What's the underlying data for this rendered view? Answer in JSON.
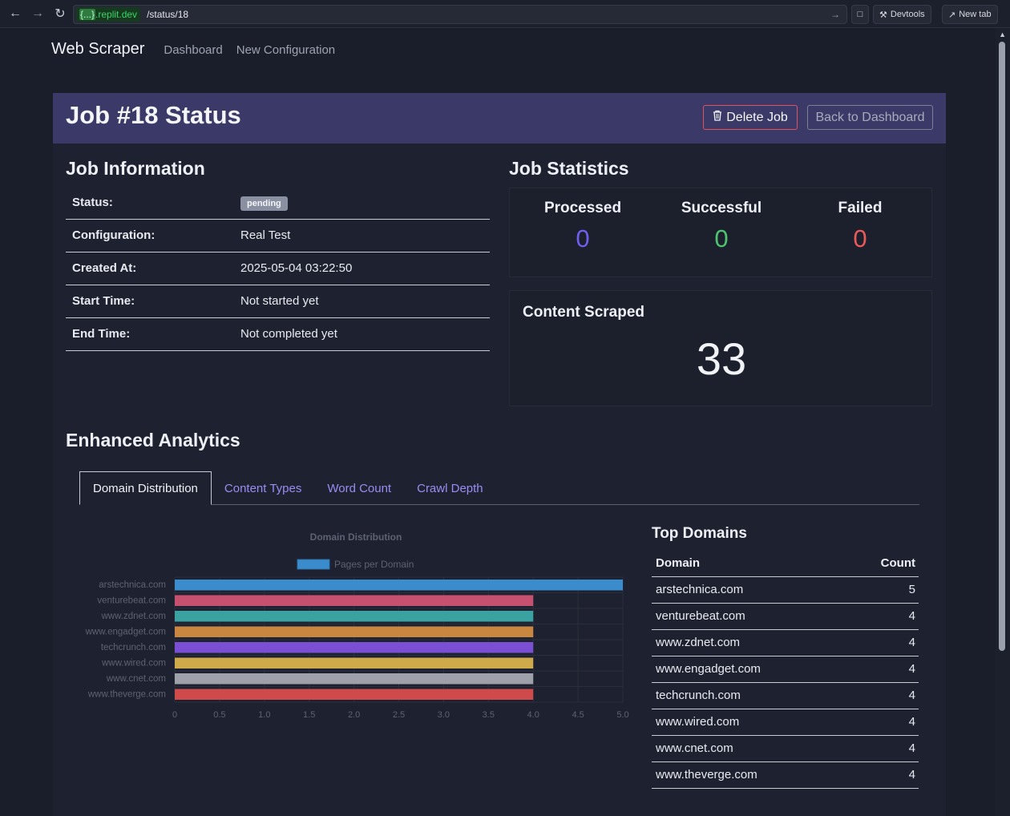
{
  "browser": {
    "url_host_brace": "{...}",
    "url_host": ".replit.dev",
    "url_path": "/status/18",
    "devtools_label": "Devtools",
    "newtab_label": "New tab"
  },
  "nav": {
    "brand": "Web Scraper",
    "links": [
      "Dashboard",
      "New Configuration"
    ]
  },
  "header": {
    "title": "Job #18 Status",
    "delete_label": "Delete Job",
    "back_label": "Back to Dashboard"
  },
  "job_info": {
    "title": "Job Information",
    "rows": [
      {
        "label": "Status:",
        "value": "pending"
      },
      {
        "label": "Configuration:",
        "value": "Real Test"
      },
      {
        "label": "Created At:",
        "value": "2025-05-04 03:22:50"
      },
      {
        "label": "Start Time:",
        "value": "Not started yet"
      },
      {
        "label": "End Time:",
        "value": "Not completed yet"
      }
    ]
  },
  "job_stats": {
    "title": "Job Statistics",
    "processed_label": "Processed",
    "processed": "0",
    "successful_label": "Successful",
    "successful": "0",
    "failed_label": "Failed",
    "failed": "0",
    "content_label": "Content Scraped",
    "content": "33",
    "colors": {
      "processed": "#6f5ef0",
      "successful": "#4fc46f",
      "failed": "#ea5a5a"
    }
  },
  "analytics": {
    "title": "Enhanced Analytics",
    "tabs": [
      "Domain Distribution",
      "Content Types",
      "Word Count",
      "Crawl Depth"
    ],
    "active_tab": 0
  },
  "chart_data": {
    "type": "bar",
    "orientation": "horizontal",
    "title": "Domain Distribution",
    "categories": [
      "arstechnica.com",
      "venturebeat.com",
      "www.zdnet.com",
      "www.engadget.com",
      "techcrunch.com",
      "www.wired.com",
      "www.cnet.com",
      "www.theverge.com"
    ],
    "series": [
      {
        "name": "Pages per Domain",
        "values": [
          5,
          4,
          4,
          4,
          4,
          4,
          4,
          4
        ]
      }
    ],
    "colors": [
      "#3a8ccd",
      "#c6506f",
      "#3aa2a0",
      "#c98641",
      "#7a4fd4",
      "#cfaa4a",
      "#9ea1aa",
      "#cf4a4a"
    ],
    "xlim": [
      0,
      5.0
    ],
    "xticks": [
      "0",
      "0.5",
      "1.0",
      "1.5",
      "2.0",
      "2.5",
      "3.0",
      "3.5",
      "4.0",
      "4.5",
      "5.0"
    ],
    "legend": "top"
  },
  "top_domains": {
    "title": "Top Domains",
    "col_domain": "Domain",
    "col_count": "Count",
    "rows": [
      {
        "domain": "arstechnica.com",
        "count": "5"
      },
      {
        "domain": "venturebeat.com",
        "count": "4"
      },
      {
        "domain": "www.zdnet.com",
        "count": "4"
      },
      {
        "domain": "www.engadget.com",
        "count": "4"
      },
      {
        "domain": "techcrunch.com",
        "count": "4"
      },
      {
        "domain": "www.wired.com",
        "count": "4"
      },
      {
        "domain": "www.cnet.com",
        "count": "4"
      },
      {
        "domain": "www.theverge.com",
        "count": "4"
      }
    ]
  }
}
